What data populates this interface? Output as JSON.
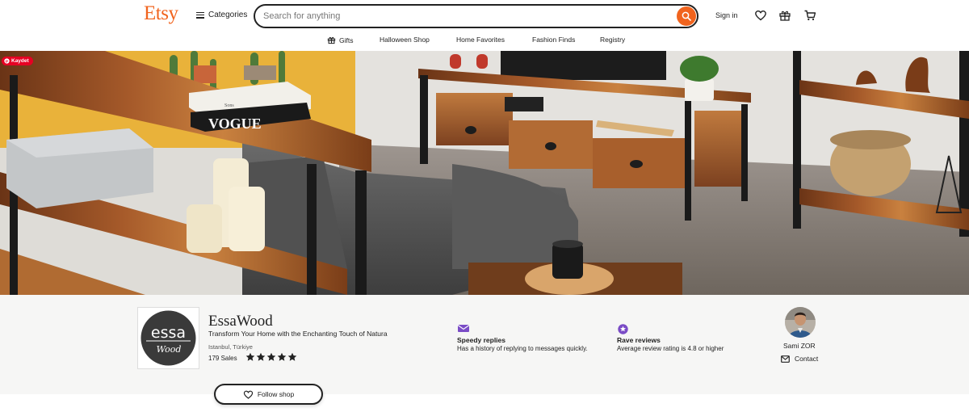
{
  "header": {
    "logo": "Etsy",
    "categories_label": "Categories",
    "search_placeholder": "Search for anything",
    "signin_label": "Sign in"
  },
  "subnav": {
    "items": [
      "Gifts",
      "Halloween Shop",
      "Home Favorites",
      "Fashion Finds",
      "Registry"
    ]
  },
  "banner": {
    "pin_label": "Kaydet",
    "vogue_text": "VOGUE",
    "book_text": "Sons"
  },
  "shop": {
    "logo_text_main": "essa",
    "logo_text_sub": "Wood",
    "name": "EssaWood",
    "tagline": "Transform Your Home with the Enchanting Touch of Natura",
    "location": "Istanbul, Türkiye",
    "sales": "179 Sales",
    "rating": 5,
    "follow_label": "Follow shop"
  },
  "badges": [
    {
      "title": "Speedy replies",
      "description": "Has a history of replying to messages quickly."
    },
    {
      "title": "Rave reviews",
      "description": "Average review rating is 4.8 or higher"
    }
  ],
  "owner": {
    "name": "Sami ZOR",
    "contact_label": "Contact"
  },
  "colors": {
    "brand": "#f1641e",
    "badge_purple": "#7a4cc6",
    "pinterest": "#e60023"
  }
}
